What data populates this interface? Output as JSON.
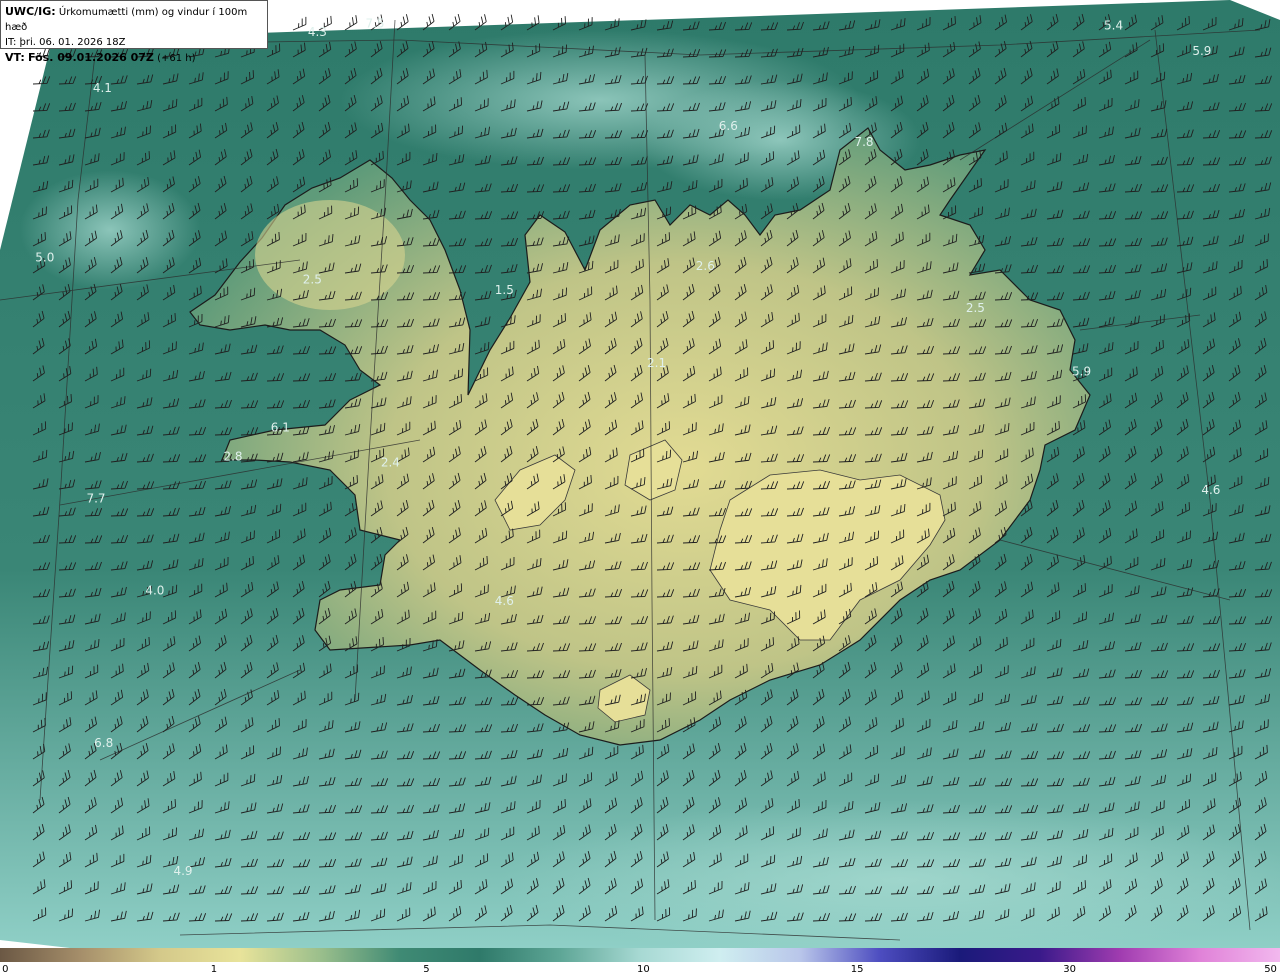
{
  "info": {
    "model_label": "UWC/IG:",
    "description": "Úrkomumætti (mm) og vindur í 100m hæð",
    "init_time": "IT: þri. 06. 01. 2026 18Z",
    "valid_label": "VT:",
    "valid_bold": "Fös. 09.01.2026 07Z",
    "lead_time": "(+61 h)"
  },
  "values": [
    {
      "label": "4.3",
      "xf": 0.248,
      "yf": 0.038
    },
    {
      "label": "7.5",
      "xf": 0.293,
      "yf": 0.029
    },
    {
      "label": "5.4",
      "xf": 0.87,
      "yf": 0.031
    },
    {
      "label": "5.9",
      "xf": 0.939,
      "yf": 0.058
    },
    {
      "label": "4.1",
      "xf": 0.08,
      "yf": 0.097
    },
    {
      "label": "6.6",
      "xf": 0.569,
      "yf": 0.137
    },
    {
      "label": "7.8",
      "xf": 0.675,
      "yf": 0.154
    },
    {
      "label": "5.0",
      "xf": 0.035,
      "yf": 0.276
    },
    {
      "label": "2.5",
      "xf": 0.244,
      "yf": 0.299
    },
    {
      "label": "2.6",
      "xf": 0.551,
      "yf": 0.285
    },
    {
      "label": "1.5",
      "xf": 0.394,
      "yf": 0.31
    },
    {
      "label": "2.5",
      "xf": 0.762,
      "yf": 0.329
    },
    {
      "label": "2.1",
      "xf": 0.513,
      "yf": 0.387
    },
    {
      "label": "5.9",
      "xf": 0.845,
      "yf": 0.396
    },
    {
      "label": "6.1",
      "xf": 0.219,
      "yf": 0.455
    },
    {
      "label": "2.8",
      "xf": 0.182,
      "yf": 0.486
    },
    {
      "label": "2.4",
      "xf": 0.305,
      "yf": 0.492
    },
    {
      "label": "7.7",
      "xf": 0.075,
      "yf": 0.53
    },
    {
      "label": "4.6",
      "xf": 0.946,
      "yf": 0.521
    },
    {
      "label": "4.0",
      "xf": 0.121,
      "yf": 0.627
    },
    {
      "label": "4.6",
      "xf": 0.394,
      "yf": 0.638
    },
    {
      "label": "6.8",
      "xf": 0.081,
      "yf": 0.788
    },
    {
      "label": "4.9",
      "xf": 0.143,
      "yf": 0.923
    }
  ],
  "colorbar": {
    "ticks": [
      "0",
      "1",
      "5",
      "10",
      "15",
      "30",
      "50"
    ],
    "colors": [
      "#6b5844",
      "#a58e6a",
      "#d4c98a",
      "#e8e39a",
      "#9bbf8c",
      "#3f8a74",
      "#2f7a6a",
      "#5ea696",
      "#a7d9d3",
      "#cfeef0",
      "#b9c6ea",
      "#4d4dc0",
      "#1a1a7a",
      "#3a1a8a",
      "#a03cb0",
      "#e082d8",
      "#f2b8ee"
    ]
  },
  "colors": {
    "sea": "#2f7c6b",
    "land_low": "#8fb37d",
    "land_high": "#d7d48c",
    "coast": "#1c1c1c"
  }
}
